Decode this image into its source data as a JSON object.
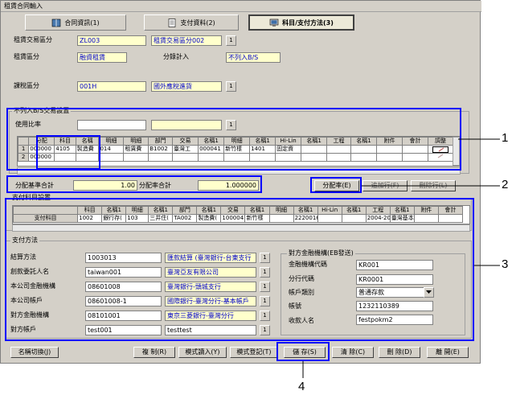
{
  "window": {
    "title": "租賃合同輸入"
  },
  "tabs": [
    {
      "label": "合同資訊(1)",
      "icon": "book-icon"
    },
    {
      "label": "支付資料(2)",
      "icon": "notepad-icon"
    },
    {
      "label": "科目/支付方法(3)",
      "icon": "monitor-icon",
      "active": true
    }
  ],
  "header": {
    "trade_cat_label": "租賃交易區分",
    "trade_cat_code": "ZL003",
    "trade_cat_name": "租賃交易區分002",
    "rent_cat_label": "租賃區分",
    "rent_cat_value": "融資租賃",
    "split_label": "分錄計入",
    "split_value": "不列入B/S",
    "tax_cat_label": "課稅區分",
    "tax_cat_code": "001H",
    "tax_cat_name": "國外應稅進貨"
  },
  "bs_group": {
    "title": "不列入B/S交易設置",
    "usage_label": "使用比率",
    "columns": [
      "分配",
      "科目",
      "名稱",
      "明細",
      "明細",
      "部門",
      "交易",
      "名稱1",
      "明細",
      "名稱1",
      "Hi-Lin",
      "名稱1",
      "工程",
      "名稱1",
      "附件",
      "會計",
      "調整"
    ],
    "rows": [
      {
        "num": "1",
        "cells": [
          "000000",
          "4105",
          "製造費",
          "014",
          "租賃費",
          "B1002",
          "臺灣工",
          "000041",
          "新竹樣",
          "1401",
          "固定資",
          "",
          "",
          "",
          "",
          "",
          ""
        ]
      },
      {
        "num": "2",
        "cells": [
          "000000",
          "",
          "",
          "",
          "",
          "",
          "",
          "",
          "",
          "",
          "",
          "",
          "",
          "",
          "",
          "",
          ""
        ]
      }
    ]
  },
  "totals": {
    "base_label": "分配基準合計",
    "base_value": "1.00",
    "ratio_label": "分配率合計",
    "ratio_value": "1.000000"
  },
  "row_buttons": {
    "alloc": "分配率(E)",
    "add": "追加行(F)",
    "delete": "刪除行(L)"
  },
  "payment_subject": {
    "title": "支付科目設置",
    "row_header": "支付科目",
    "columns": [
      "科目",
      "名稱1",
      "明細",
      "名稱1",
      "部門",
      "名稱1",
      "交易",
      "名稱1",
      "明細",
      "名稱1",
      "Hi-Lin",
      "名稱1",
      "工程",
      "名稱1",
      "附件",
      "會計"
    ],
    "cells": [
      "1002",
      "銀行存(",
      "103",
      "三井住(",
      "TA002",
      "製造費(",
      "1000041",
      "新竹樣",
      "",
      "2220016",
      "",
      "",
      "2004-20",
      "臺灣基本",
      "",
      ""
    ]
  },
  "payment": {
    "title": "支付方法",
    "settle_label": "結算方法",
    "settle_code": "1003013",
    "settle_name": "匯款結算 (臺灣銀行-台東支行",
    "trustee_label": "創款委託人名",
    "trustee_code": "taiwan001",
    "trustee_name": "臺灣亞友有限公司",
    "bank_label": "本公司金融機構",
    "bank_code": "08601008",
    "bank_name": "臺灣銀行-頭城支行",
    "account_label": "本公司帳戶",
    "account_code": "08601008-1",
    "account_name": "國際銀行-臺灣分行-基本帳戶",
    "cp_bank_label": "對方金融機構",
    "cp_bank_code": "08101001",
    "cp_bank_name": "東京三菱銀行-臺灣分行",
    "cp_account_label": "對方帳戶",
    "cp_account_code": "test001",
    "cp_account_name": "testtest"
  },
  "eb": {
    "title": "對方金融機構(EB發送)",
    "code_label": "金融機構代碼",
    "code_value": "KR001",
    "branch_label": "分行代碼",
    "branch_value": "KR0001",
    "type_label": "帳戶類別",
    "type_value": "普通存款",
    "account_label": "帳號",
    "account_value": "1232110389",
    "holder_label": "收款人名",
    "holder_value": "festpokm2"
  },
  "footer": {
    "switch": "名稱切換(J)",
    "copy": "複 制(R)",
    "import": "模式讀入(Y)",
    "register": "模式登記(T)",
    "save": "儲 存(S)",
    "clear": "清 除(C)",
    "delete": "刪 除(D)",
    "close": "離 開(E)"
  },
  "small_button": "1",
  "callouts": [
    "1",
    "2",
    "3",
    "4"
  ],
  "colors": {
    "highlight": "#0000ff",
    "field_bg": "#ffffcc",
    "link_text": "#0000c8",
    "window_bg": "#d4d0c8"
  }
}
